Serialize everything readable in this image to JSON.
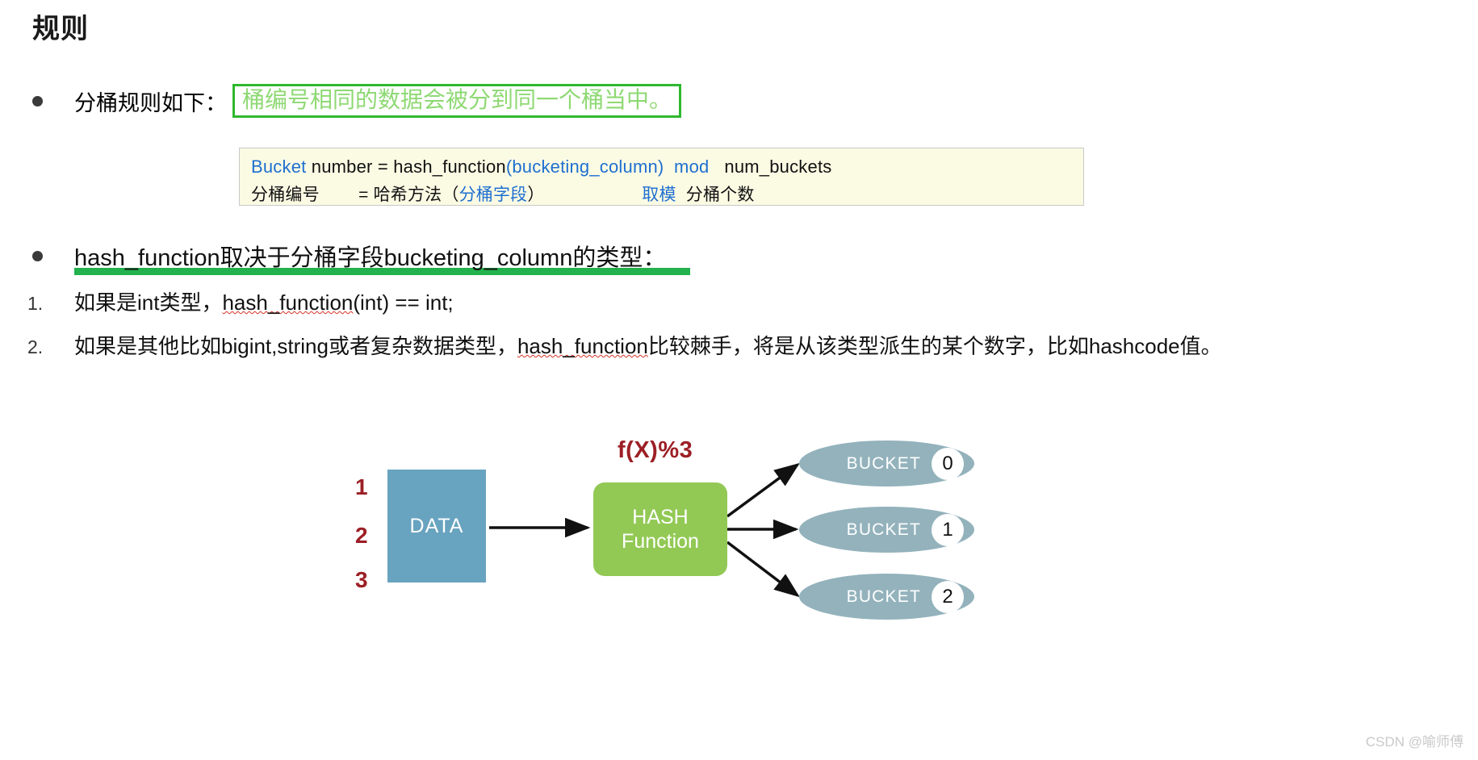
{
  "title": "规则",
  "bullet1": {
    "label": "分桶规则如下：",
    "highlight_box_text": "桶编号相同的数据会被分到同一个桶当中。",
    "box_border_color": "#2eb82e",
    "box_text_color": "#8ed973"
  },
  "formula": {
    "line1": {
      "seg1": "Bucket",
      "seg2": " number = hash_function",
      "seg3": "(bucketing_column)",
      "seg4": "  mod",
      "seg5": "   num_buckets"
    },
    "line2": {
      "seg1": "分桶编号        = 哈希方法（",
      "seg2": "分桶字段",
      "seg3": "）                    ",
      "seg4": "取模",
      "seg5": "  分桶个数"
    },
    "background": "#fbfbe4",
    "blue": "#1f6fd0"
  },
  "bullet2": {
    "text": "hash_function取决于分桶字段bucketing_column的类型：",
    "underline_color": "#22b14c"
  },
  "numbered_list": [
    {
      "marker": "1.",
      "pre": "如果是int类型，",
      "code": "hash_function",
      "post": "(int) == int;"
    },
    {
      "marker": "2.",
      "pre": "如果是其他比如bigint,string或者复杂数据类型，",
      "code": "hash_function",
      "post": "比较棘手，将是从该类型派生的某个数字，比如hashcode值。"
    }
  ],
  "diagram": {
    "fx_label": "f(X)%3",
    "data_numbers": [
      "1",
      "2",
      "3"
    ],
    "data_box_label": "DATA",
    "data_box_color": "#68a3c0",
    "hash_box_line1": "HASH",
    "hash_box_line2": "Function",
    "hash_box_color": "#92c955",
    "bucket_color": "#93b2bc",
    "buckets": [
      {
        "label": "BUCKET",
        "number": "0"
      },
      {
        "label": "BUCKET",
        "number": "1"
      },
      {
        "label": "BUCKET",
        "number": "2"
      }
    ]
  },
  "watermark": "CSDN @喻师傅"
}
